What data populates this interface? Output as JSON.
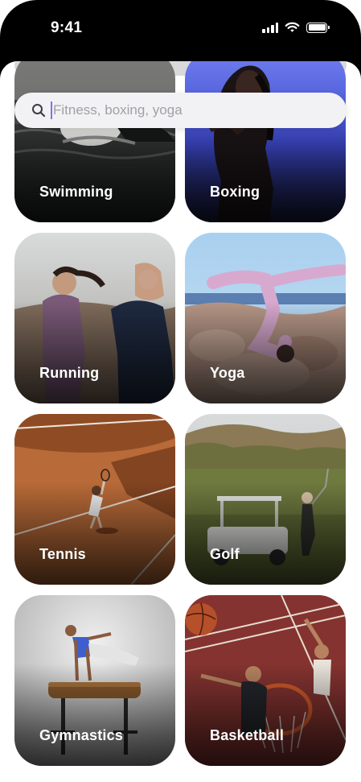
{
  "status_bar": {
    "time": "9:41",
    "signal_icon": "cellular-signal-icon",
    "wifi_icon": "wifi-icon",
    "battery_icon": "battery-icon"
  },
  "search": {
    "placeholder": "Fitness, boxing, yoga",
    "value": "",
    "icon": "search-icon",
    "caret_color": "#8a6cf2"
  },
  "sports": [
    {
      "label": "Swimming",
      "id": "swimming"
    },
    {
      "label": "Boxing",
      "id": "boxing"
    },
    {
      "label": "Running",
      "id": "running"
    },
    {
      "label": "Yoga",
      "id": "yoga"
    },
    {
      "label": "Tennis",
      "id": "tennis"
    },
    {
      "label": "Golf",
      "id": "golf"
    },
    {
      "label": "Gymnastics",
      "id": "gymnastics"
    },
    {
      "label": "Basketball",
      "id": "basketball"
    }
  ],
  "colors": {
    "status_bar_bg": "#000000",
    "tile_label": "#ffffff",
    "search_bg": "#f2f2f4"
  }
}
